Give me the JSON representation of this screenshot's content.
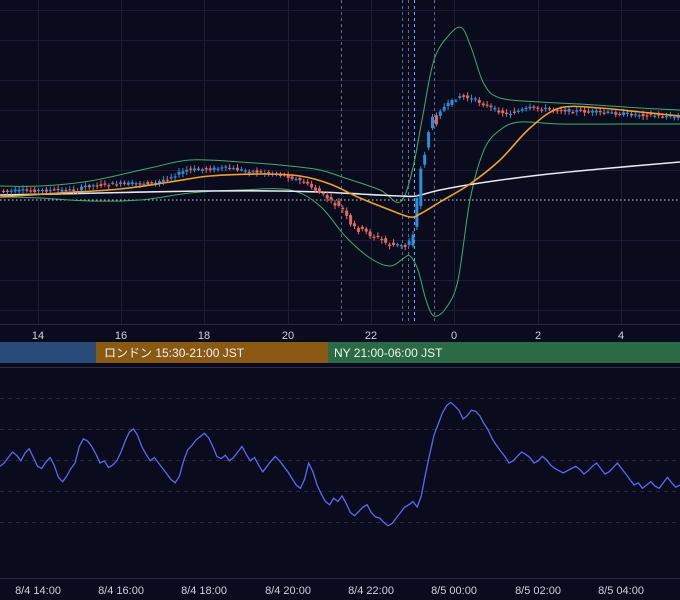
{
  "chart_data": [
    {
      "type": "candlestick",
      "panel": "price",
      "x_ticks": [
        "14",
        "16",
        "18",
        "20",
        "22",
        "0",
        "2",
        "4"
      ],
      "overlays": [
        "bollinger-upper",
        "bollinger-lower",
        "moving-average-orange",
        "moving-average-white"
      ],
      "sessions": [
        {
          "label": "",
          "color": "#2a4a7a"
        },
        {
          "label": "ロンドン 15:30-21:00 JST",
          "color": "#8a5a14"
        },
        {
          "label": "NY 21:00-06:00 JST",
          "color": "#2a6a44"
        }
      ],
      "colors": {
        "up": "#2e8fd8",
        "down": "#e06a62",
        "bb": "#3fae6a",
        "ma_fast": "#f0a030",
        "ma_slow": "#e8e8ee"
      }
    },
    {
      "type": "line",
      "panel": "oscillator",
      "x_ticks": [
        "8/4 14:00",
        "8/4 16:00",
        "8/4 18:00",
        "8/4 20:00",
        "8/4 22:00",
        "8/5 00:00",
        "8/5 02:00",
        "8/5 04:00"
      ],
      "series": [
        {
          "values": [
            0.47,
            0.5,
            0.55,
            0.6,
            0.57,
            0.52,
            0.59,
            0.63,
            0.55,
            0.47,
            0.45,
            0.51,
            0.55,
            0.48,
            0.37,
            0.33,
            0.38,
            0.45,
            0.5,
            0.65,
            0.72,
            0.7,
            0.65,
            0.58,
            0.5,
            0.52,
            0.46,
            0.48,
            0.52,
            0.6,
            0.7,
            0.78,
            0.81,
            0.75,
            0.65,
            0.58,
            0.52,
            0.55,
            0.5,
            0.45,
            0.4,
            0.35,
            0.32,
            0.38,
            0.52,
            0.62,
            0.66,
            0.71,
            0.74,
            0.77,
            0.73,
            0.65,
            0.56,
            0.54,
            0.57,
            0.52,
            0.55,
            0.6,
            0.65,
            0.58,
            0.52,
            0.55,
            0.48,
            0.42,
            0.47,
            0.52,
            0.56,
            0.52,
            0.47,
            0.42,
            0.36,
            0.3,
            0.27,
            0.35,
            0.5,
            0.42,
            0.3,
            0.22,
            0.15,
            0.12,
            0.18,
            0.15,
            0.2,
            0.13,
            0.05,
            0.02,
            0.06,
            0.1,
            0.12,
            0.05,
            0.01,
            0.0,
            -0.04,
            -0.07,
            -0.05,
            0.0,
            0.05,
            0.1,
            0.12,
            0.15,
            0.1,
            0.2,
            0.4,
            0.58,
            0.75,
            0.85,
            0.95,
            1.02,
            1.05,
            1.02,
            0.98,
            0.9,
            0.93,
            0.98,
            0.97,
            0.93,
            0.86,
            0.8,
            0.72,
            0.66,
            0.61,
            0.56,
            0.5,
            0.52,
            0.56,
            0.6,
            0.58,
            0.55,
            0.5,
            0.52,
            0.56,
            0.53,
            0.48,
            0.45,
            0.43,
            0.41,
            0.43,
            0.45,
            0.47,
            0.44,
            0.4,
            0.43,
            0.47,
            0.5,
            0.45,
            0.4,
            0.42,
            0.46,
            0.5,
            0.45,
            0.4,
            0.35,
            0.3,
            0.32,
            0.27,
            0.3,
            0.33,
            0.29,
            0.27,
            0.32,
            0.37,
            0.32,
            0.28,
            0.3
          ]
        }
      ]
    }
  ]
}
